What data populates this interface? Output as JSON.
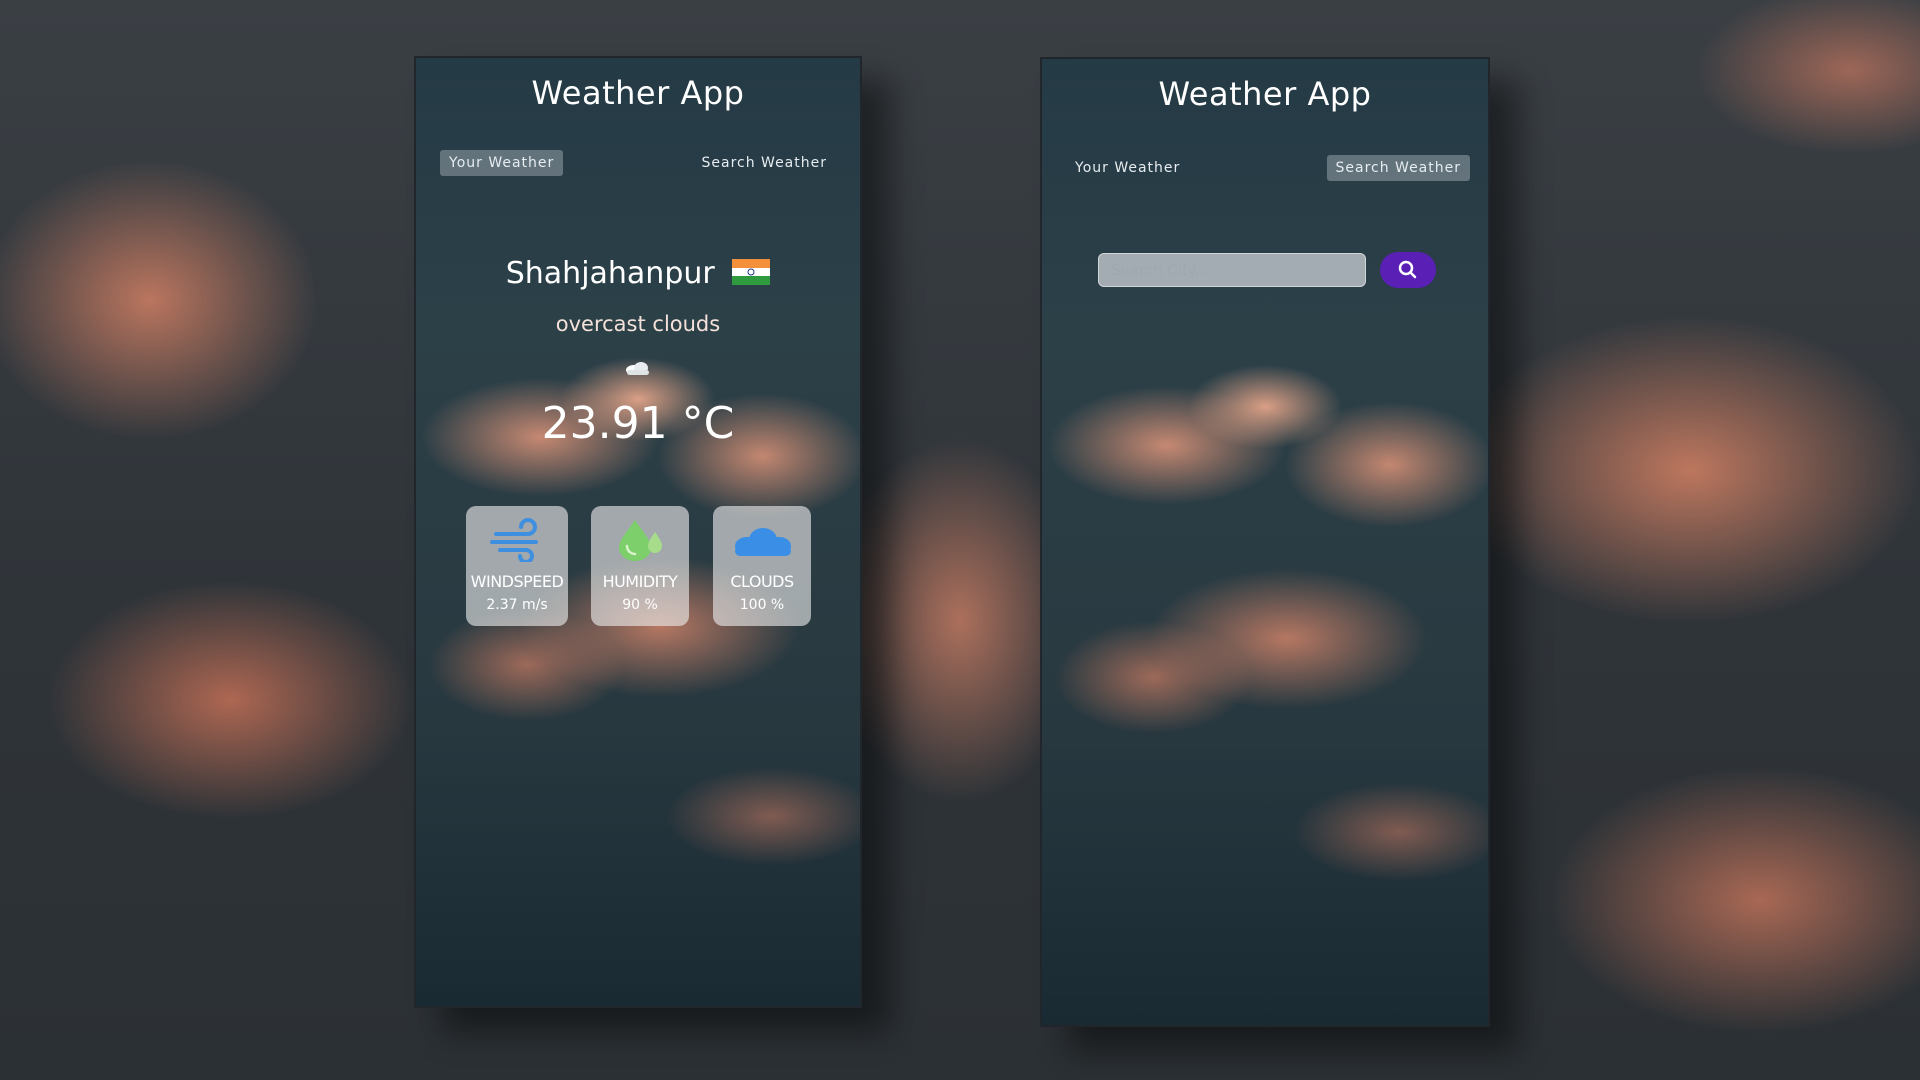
{
  "app": {
    "title": "Weather App"
  },
  "tabs": {
    "your_weather": "Your Weather",
    "search_weather": "Search Weather"
  },
  "current": {
    "city": "Shahjahanpur",
    "description": "overcast clouds",
    "temperature": "23.91 °C"
  },
  "stats": [
    {
      "label": "WINDSPEED",
      "value": "2.37 m/s"
    },
    {
      "label": "HUMIDITY",
      "value": "90 %"
    },
    {
      "label": "CLOUDS",
      "value": "100 %"
    }
  ],
  "search": {
    "placeholder": "Search City..."
  },
  "colors": {
    "search_button": "#5a1fb4",
    "wind_icon": "#3f8fe0",
    "humidity_icon": "#7ccf6a",
    "clouds_icon": "#3a8ee6"
  },
  "icons": {
    "weather": "overcast-cloud-icon",
    "windspeed": "wind-icon",
    "humidity": "humidity-drop-icon",
    "clouds": "cloud-icon",
    "search": "search-icon",
    "flag": "india-flag-icon"
  }
}
